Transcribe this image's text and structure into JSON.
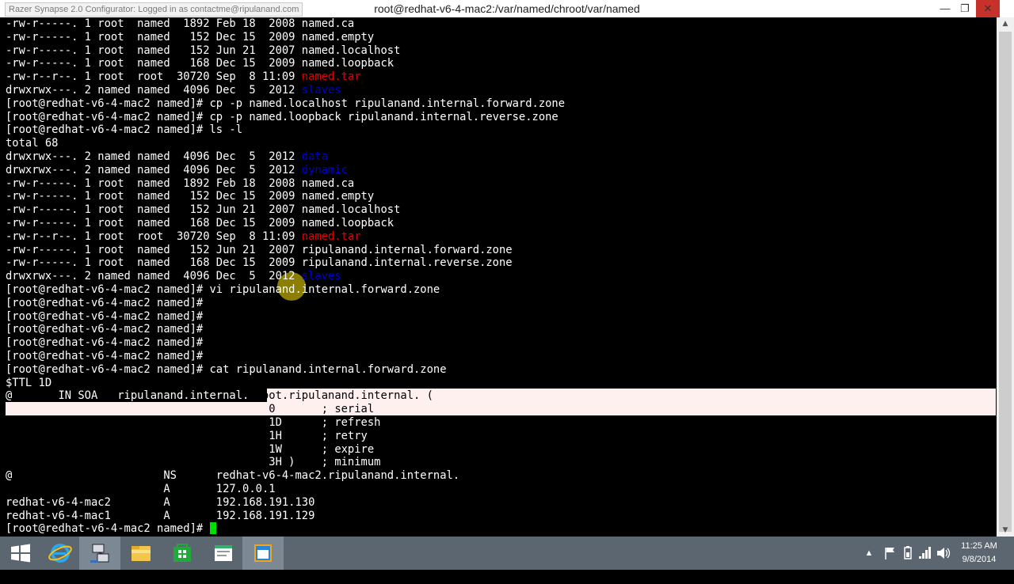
{
  "window": {
    "tooltip": "Razer Synapse 2.0 Configurator: Logged in as contactme@ripulanand.com",
    "title": "root@redhat-v6-4-mac2:/var/named/chroot/var/named",
    "min_glyph": "—",
    "max_glyph": "❐",
    "close_glyph": "✕"
  },
  "terminal": {
    "l1": "-rw-r-----. 1 root  named  1892 Feb 18  2008 named.ca",
    "l2": "-rw-r-----. 1 root  named   152 Dec 15  2009 named.empty",
    "l3": "-rw-r-----. 1 root  named   152 Jun 21  2007 named.localhost",
    "l4": "-rw-r-----. 1 root  named   168 Dec 15  2009 named.loopback",
    "l5a": "-rw-r--r--. 1 root  root  30720 Sep  8 11:09 ",
    "l5b": "named.tar",
    "l6a": "drwxrwx---. 2 named named  4096 Dec  5  2012 ",
    "l6b": "slaves",
    "l7": "[root@redhat-v6-4-mac2 named]# cp -p named.localhost ripulanand.internal.forward.zone",
    "l8": "[root@redhat-v6-4-mac2 named]# cp -p named.loopback ripulanand.internal.reverse.zone",
    "l9": "[root@redhat-v6-4-mac2 named]# ls -l",
    "l10": "total 68",
    "l11a": "drwxrwx---. 2 named named  4096 Dec  5  2012 ",
    "l11b": "data",
    "l12a": "drwxrwx---. 2 named named  4096 Dec  5  2012 ",
    "l12b": "dynamic",
    "l13": "-rw-r-----. 1 root  named  1892 Feb 18  2008 named.ca",
    "l14": "-rw-r-----. 1 root  named   152 Dec 15  2009 named.empty",
    "l15": "-rw-r-----. 1 root  named   152 Jun 21  2007 named.localhost",
    "l16": "-rw-r-----. 1 root  named   168 Dec 15  2009 named.loopback",
    "l17a": "-rw-r--r--. 1 root  root  30720 Sep  8 11:09 ",
    "l17b": "named.tar",
    "l18": "-rw-r-----. 1 root  named   152 Jun 21  2007 ripulanand.internal.forward.zone",
    "l19": "-rw-r-----. 1 root  named   168 Dec 15  2009 ripulanand.internal.reverse.zone",
    "l20a": "drwxrwx---. 2 named named  4096 Dec  5  2012 ",
    "l20b": "slaves",
    "l21": "[root@redhat-v6-4-mac2 named]# vi ripulanand.internal.forward.zone",
    "l22": "[root@redhat-v6-4-mac2 named]#",
    "l23": "[root@redhat-v6-4-mac2 named]#",
    "l24": "[root@redhat-v6-4-mac2 named]#",
    "l25": "[root@redhat-v6-4-mac2 named]#",
    "l26": "[root@redhat-v6-4-mac2 named]#",
    "l27": "[root@redhat-v6-4-mac2 named]# cat ripulanand.internal.forward.zone",
    "l28": "$TTL 1D",
    "l29a": "@       IN SOA   ripulanand.internal. ",
    "l29b": "root.ripulanand.internal. (",
    "l30": "                                        0       ; serial",
    "l31": "                                        1D      ; refresh",
    "l32": "                                        1H      ; retry",
    "l33": "                                        1W      ; expire",
    "l34": "                                        3H )    ; minimum",
    "l35": "@                       NS      redhat-v6-4-mac2.ripulanand.internal.",
    "l36": "                        A       127.0.0.1",
    "l37": "redhat-v6-4-mac2        A       192.168.191.130",
    "l38": "redhat-v6-4-mac1        A       192.168.191.129",
    "l39": "[root@redhat-v6-4-mac2 named]# "
  },
  "taskbar": {
    "clock_time": "11:25 AM",
    "clock_date": "9/8/2014",
    "apps": [
      "start-icon",
      "internet-explorer-icon",
      "network-app-icon",
      "file-explorer-icon",
      "store-icon",
      "notepad-app-icon",
      "window-app-icon"
    ],
    "tray": [
      "chevron-up-icon",
      "flag-icon",
      "battery-icon",
      "signal-icon",
      "volume-icon"
    ]
  },
  "colors": {
    "terminal_bg": "#000000",
    "selection_bg": "#fff0f0",
    "file_red": "#e00000",
    "dir_blue": "#0000d0",
    "cursor_green": "#00e000",
    "taskbar": "#5b6670"
  }
}
